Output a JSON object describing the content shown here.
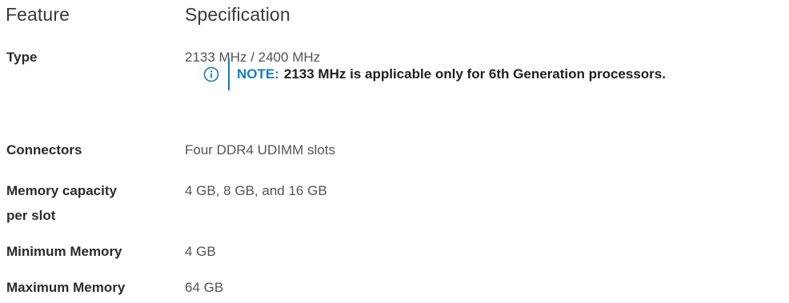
{
  "table": {
    "header": {
      "feature": "Feature",
      "specification": "Specification"
    },
    "rows": [
      {
        "label": "Type",
        "value": "2133 MHz / 2400 MHz"
      },
      {
        "label": "Connectors",
        "value": "Four DDR4 UDIMM slots"
      },
      {
        "label_line1": "Memory capacity",
        "label_line2": "per slot",
        "value": "4 GB, 8 GB, and 16 GB"
      },
      {
        "label": "Minimum Memory",
        "value": "4 GB"
      },
      {
        "label": "Maximum Memory",
        "value": "64 GB"
      }
    ],
    "note": {
      "label": "NOTE:",
      "text": "2133 MHz is applicable only for 6th Generation processors.",
      "icon": "info-icon",
      "accent_color": "#0f7fc2"
    }
  }
}
